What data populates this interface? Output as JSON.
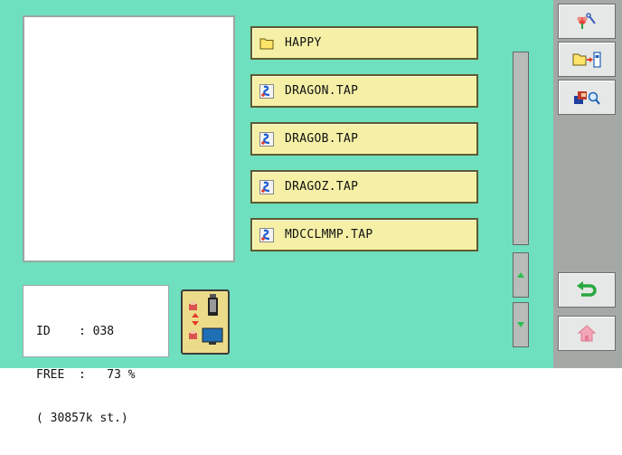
{
  "info": {
    "id_line": "ID    : 038",
    "free_line": "FREE  :   73 %",
    "stitch_line": "( 30857k st.)"
  },
  "files": [
    {
      "name": "HAPPY",
      "type": "folder"
    },
    {
      "name": "DRAGON.TAP",
      "type": "design"
    },
    {
      "name": "DRAGOB.TAP",
      "type": "design"
    },
    {
      "name": "DRAGOZ.TAP",
      "type": "design"
    },
    {
      "name": "MDCCLMMP.TAP",
      "type": "design"
    }
  ],
  "toolbar": {
    "top": [
      "design-view-icon",
      "folder-export-icon",
      "design-search-icon"
    ],
    "bottom": [
      "return-icon",
      "home-icon"
    ]
  },
  "colors": {
    "background": "#6ee0bf",
    "file_button": "#f5f0a6",
    "side_panel": "#a4a9a6"
  }
}
